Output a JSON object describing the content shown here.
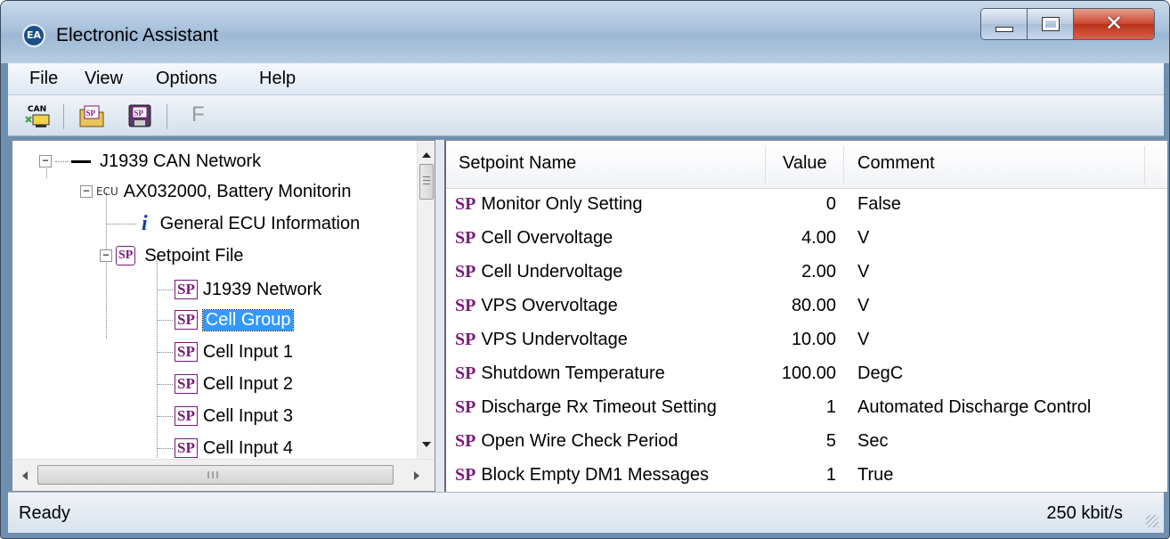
{
  "window": {
    "title": "Electronic Assistant",
    "app_icon_text": "EA"
  },
  "menubar": {
    "items": [
      "File",
      "View",
      "Options",
      "Help"
    ]
  },
  "toolbar": {
    "f_label": "F",
    "can_label": "CAN",
    "sp_label": "SP"
  },
  "tree": {
    "network": "J1939 CAN Network",
    "ecu_tag": "ECU",
    "ecu": "AX032000, Battery Monitorin",
    "info": "General ECU Information",
    "setpoint_file": "Setpoint File",
    "sp_tag": "SP",
    "info_tag": "i",
    "collapse_glyph": "−",
    "children": [
      "J1939 Network",
      "Cell Group",
      "Cell Input 1",
      "Cell Input 2",
      "Cell Input 3",
      "Cell Input 4"
    ],
    "selected": "Cell Group"
  },
  "table": {
    "headers": {
      "name": "Setpoint Name",
      "value": "Value",
      "comment": "Comment"
    },
    "sp_tag": "SP",
    "rows": [
      {
        "name": "Monitor Only Setting",
        "value": "0",
        "comment": "False"
      },
      {
        "name": "Cell Overvoltage",
        "value": "4.00",
        "comment": "V"
      },
      {
        "name": "Cell Undervoltage",
        "value": "2.00",
        "comment": "V"
      },
      {
        "name": "VPS Overvoltage",
        "value": "80.00",
        "comment": "V"
      },
      {
        "name": "VPS Undervoltage",
        "value": "10.00",
        "comment": "V"
      },
      {
        "name": "Shutdown Temperature",
        "value": "100.00",
        "comment": "DegC"
      },
      {
        "name": "Discharge Rx Timeout Setting",
        "value": "1",
        "comment": "Automated Discharge Control"
      },
      {
        "name": "Open Wire Check Period",
        "value": "5",
        "comment": "Sec"
      },
      {
        "name": "Block Empty DM1 Messages",
        "value": "1",
        "comment": "True"
      }
    ]
  },
  "status": {
    "left": "Ready",
    "right": "250 kbit/s"
  },
  "colors": {
    "sp_purple": "#7a1a7a",
    "selection": "#3399ff",
    "title_bar": "#a9c2dc"
  }
}
